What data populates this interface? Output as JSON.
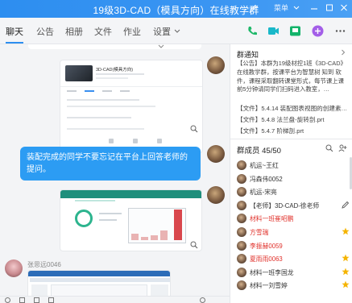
{
  "window": {
    "title": "19级3D-CAD（模具方向）在线教学群",
    "menu_label": "菜单"
  },
  "tabs": [
    {
      "label": "聊天"
    },
    {
      "label": "公告"
    },
    {
      "label": "相册"
    },
    {
      "label": "文件"
    },
    {
      "label": "作业"
    },
    {
      "label": "设置"
    }
  ],
  "chat": {
    "sender_name": "张思远0046",
    "bubble_text": "装配完成的同学不要忘记在平台上回答老师的提问。",
    "shared_card_title": "3D-CAD(模具方向)"
  },
  "notice": {
    "title": "群通知",
    "body": "【公告】本群为19级材控1班《3D-CAD》在线教学群，按课平台为智慧树 知到 软件，课程采取翻转课堂形式，每节课上课前5分钟请同学们扫码进入教室，…",
    "files": [
      "【文件】5.4.14 装配图表视图的创建素…",
      "【文件】5.4.8 法兰盘-旋转剖.prt",
      "【文件】5.4.7 阶梯剖.prt"
    ]
  },
  "members": {
    "title": "群成员 45/50",
    "list": [
      {
        "name": "机运~王红",
        "color": "normal",
        "badge": "none"
      },
      {
        "name": "冯森伟0052",
        "color": "normal",
        "badge": "none"
      },
      {
        "name": "机运-宋亮",
        "color": "normal",
        "badge": "none"
      },
      {
        "name": "【老师】3D-CAD-徐老师",
        "color": "normal",
        "badge": "owner"
      },
      {
        "name": "材料一班崔昭鹏",
        "color": "red",
        "badge": "none"
      },
      {
        "name": "方雪瑞",
        "color": "red",
        "badge": "star"
      },
      {
        "name": "李振赫0059",
        "color": "red",
        "badge": "none"
      },
      {
        "name": "夏雨雨0063",
        "color": "red",
        "badge": "star"
      },
      {
        "name": "材料一班李国龙",
        "color": "normal",
        "badge": "star"
      },
      {
        "name": "材料一刘雪婷",
        "color": "normal",
        "badge": "star"
      }
    ]
  },
  "colors": {
    "accent": "#2d8ef0",
    "bubble": "#2c9cf3",
    "red_name": "#e0302a",
    "star": "#f5b400"
  }
}
